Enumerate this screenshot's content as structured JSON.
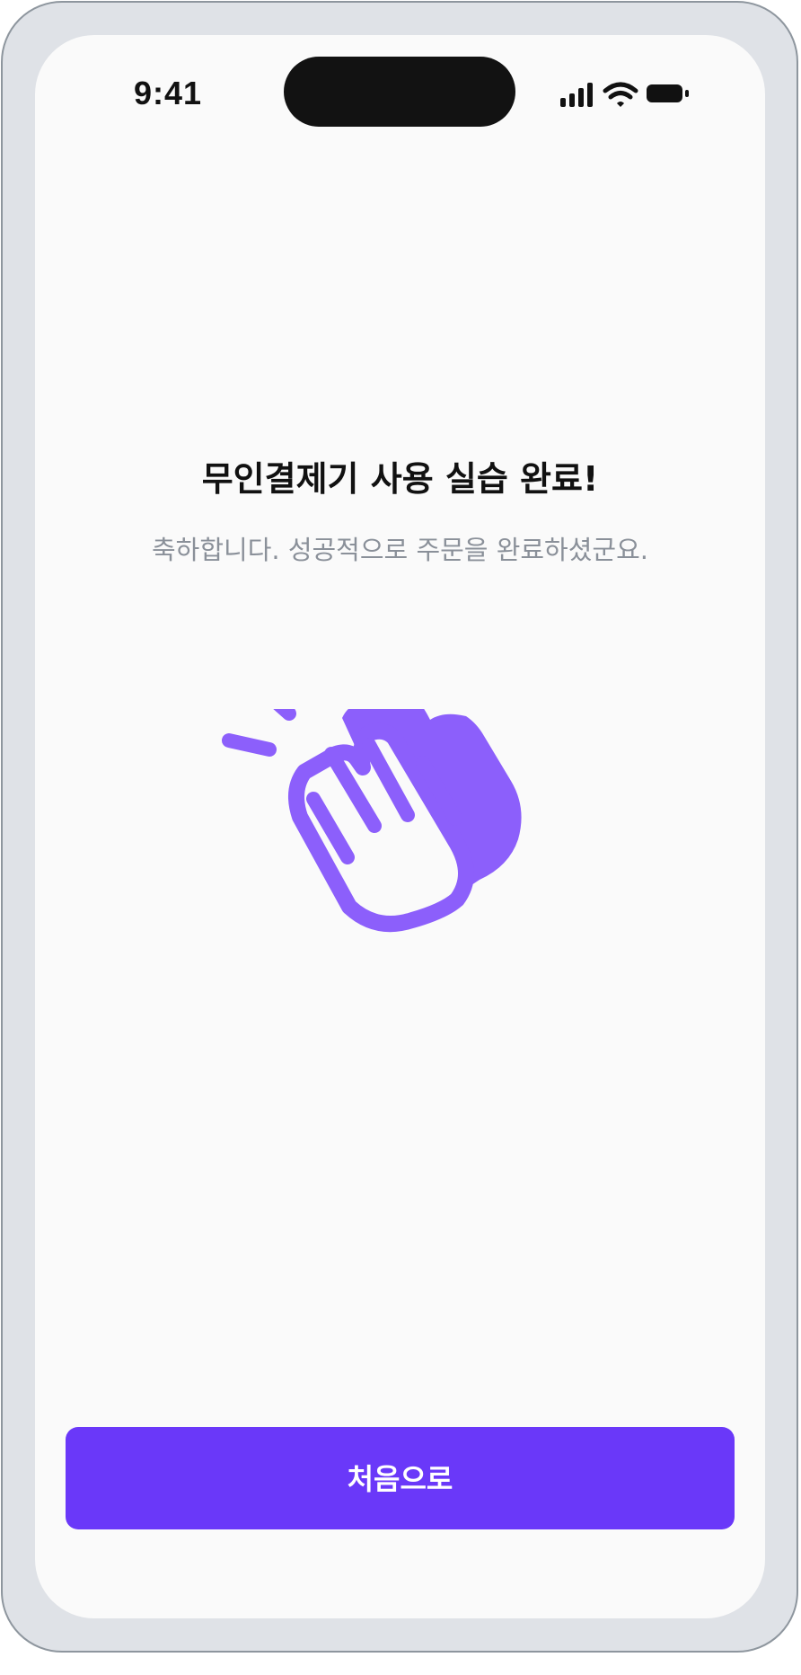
{
  "status_bar": {
    "time": "9:41",
    "icons": [
      "cellular-signal-icon",
      "wifi-icon",
      "battery-icon"
    ]
  },
  "main": {
    "title": "무인결제기 사용 실습 완료!",
    "subtitle": "축하합니다. 성공적으로 주문을 완료하셨군요.",
    "illustration_icon": "clapping-hands-icon"
  },
  "footer": {
    "button_label": "처음으로",
    "pointer_icon": "tap-pointer-hand-icon"
  },
  "colors": {
    "accent": "#6a38f9",
    "illustration": "#8c5ffb",
    "frame": "#dfe2e7",
    "screen_bg": "#fafafa",
    "title_text": "#111111",
    "subtitle_text": "#8a9099"
  }
}
